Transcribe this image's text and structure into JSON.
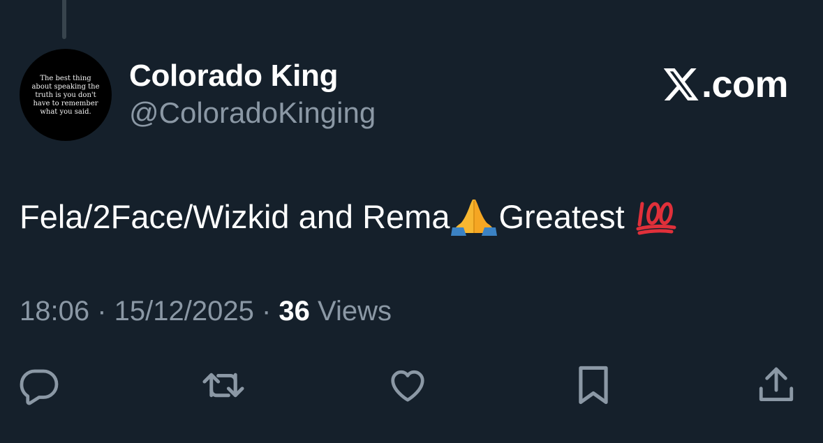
{
  "tweet": {
    "author": {
      "display_name": "Colorado King",
      "handle": "@ColoradoKinging",
      "avatar_text": "The best thing about speaking the truth is you don't have to remember what you said."
    },
    "brand": {
      "icon": "x-logo-icon",
      "label": ".com"
    },
    "text": {
      "part1": "Fela/2Face/Wizkid and Rema",
      "emoji1": "folded-hands-emoji",
      "part2": "Greatest ",
      "emoji2": "hundred-points-emoji"
    },
    "meta": {
      "time": "18:06",
      "separator": " · ",
      "date": "15/12/2025",
      "views_count": "36",
      "views_label": " Views"
    },
    "actions": [
      {
        "name": "reply",
        "icon": "reply-icon"
      },
      {
        "name": "retweet",
        "icon": "retweet-icon"
      },
      {
        "name": "like",
        "icon": "heart-icon"
      },
      {
        "name": "bookmark",
        "icon": "bookmark-icon"
      },
      {
        "name": "share",
        "icon": "share-icon"
      }
    ],
    "colors": {
      "background": "#15202b",
      "primary_text": "#ffffff",
      "secondary_text": "#8b98a5",
      "thread_line": "#38444d"
    }
  }
}
